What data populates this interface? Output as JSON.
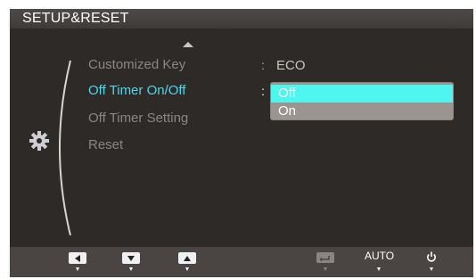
{
  "osd": {
    "title": "SETUP&RESET",
    "menu_items": [
      {
        "label": "Customized Key",
        "value": "ECO",
        "colon": ":"
      },
      {
        "label": "Off Timer On/Off",
        "colon": ":"
      },
      {
        "label": "Off Timer Setting"
      },
      {
        "label": "Reset"
      }
    ],
    "dropdown": {
      "options": [
        "Off",
        "On"
      ],
      "selected": "Off"
    },
    "bottom": {
      "buttons": [
        {
          "icon": "left-arrow-icon"
        },
        {
          "icon": "down-arrow-icon"
        },
        {
          "icon": "up-arrow-icon"
        },
        {
          "icon": "enter-icon"
        },
        {
          "label": "AUTO"
        },
        {
          "icon": "power-icon"
        }
      ]
    },
    "colors": {
      "background": "#2e2a28",
      "active_text": "#54d2e8",
      "inactive_text": "#8a8683",
      "selection": "#4ff6f0"
    }
  }
}
